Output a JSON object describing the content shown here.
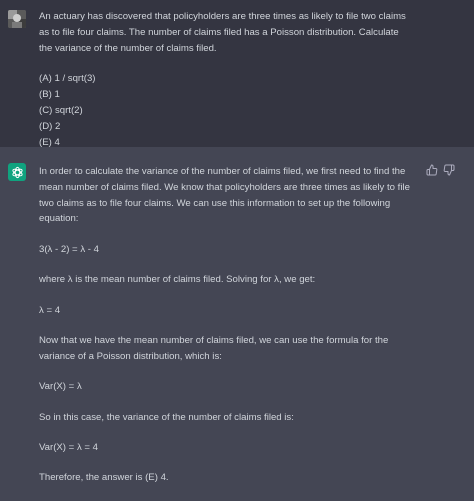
{
  "user": {
    "question": "An actuary has discovered that policyholders are three times as likely to file two claims as to file four claims. The number of claims filed has a Poisson distribution. Calculate the variance of the number of claims filed.",
    "options": [
      "(A) 1 / sqrt(3)",
      "(B) 1",
      "(C) sqrt(2)",
      "(D) 2",
      "(E) 4"
    ]
  },
  "assistant": {
    "paragraphs": [
      "In order to calculate the variance of the number of claims filed, we first need to find the mean number of claims filed. We know that policyholders are three times as likely to file two claims as to file four claims. We can use this information to set up the following equation:",
      "3(λ - 2) = λ - 4",
      "where λ is the mean number of claims filed. Solving for λ, we get:",
      "λ = 4",
      "Now that we have the mean number of claims filed, we can use the formula for the variance of a Poisson distribution, which is:",
      "Var(X) = λ",
      "So in this case, the variance of the number of claims filed is:",
      "Var(X) = λ = 4",
      "Therefore, the answer is (E) 4."
    ]
  },
  "icons": {
    "user_avatar": "user-avatar-icon",
    "assistant_avatar": "openai-logo-icon",
    "thumbs_up": "thumbs-up-icon",
    "thumbs_down": "thumbs-down-icon"
  },
  "colors": {
    "user_bg": "#343541",
    "assistant_bg": "#444654",
    "text": "#d1d5db",
    "accent": "#10a37f"
  }
}
